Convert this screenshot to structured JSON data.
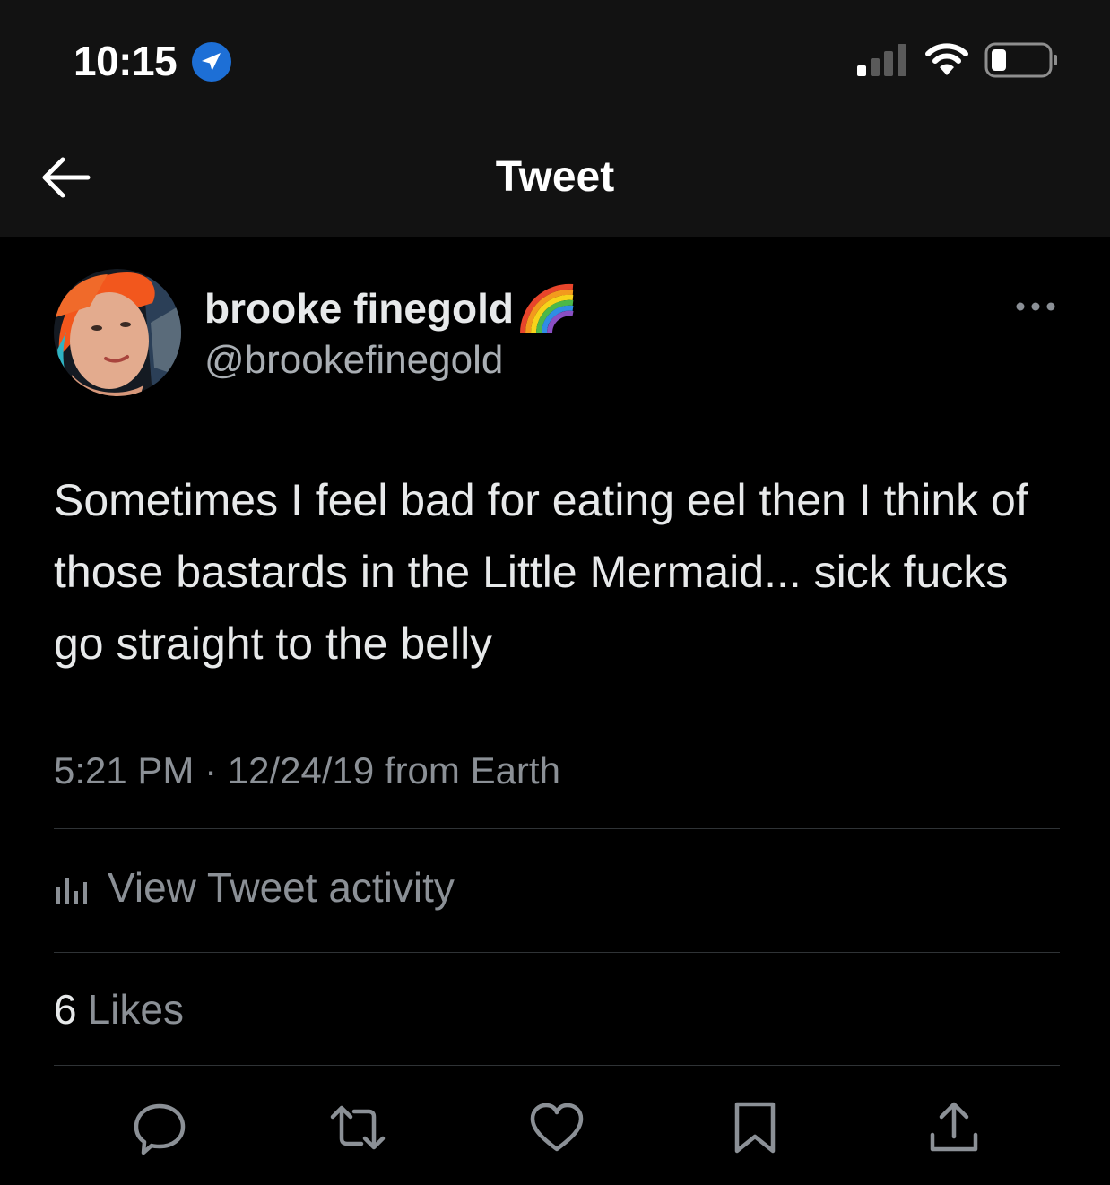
{
  "status_bar": {
    "time": "10:15",
    "icons": [
      "location-arrow-icon",
      "cellular-signal-icon",
      "wifi-icon",
      "battery-icon"
    ]
  },
  "nav": {
    "title": "Tweet",
    "back_icon": "arrow-left-icon"
  },
  "tweet": {
    "author": {
      "display_name": "brooke finegold",
      "name_emoji": "rainbow-icon",
      "handle": "@brookefinegold"
    },
    "text": "Sometimes I feel bad for eating eel then I think of those bastards in the Little Mermaid... sick fucks go straight to the belly",
    "meta": "5:21 PM · 12/24/19 from Earth",
    "activity_label": "View Tweet activity",
    "likes_count": "6",
    "likes_label": "Likes"
  },
  "actions": [
    "reply-icon",
    "retweet-icon",
    "like-icon",
    "bookmark-icon",
    "share-icon"
  ],
  "colors": {
    "background": "#000000",
    "header_background": "#121212",
    "text_primary": "#e7e9ea",
    "text_secondary": "#8b9096",
    "divider": "#2f3336",
    "location_blue": "#1d6fd6"
  }
}
